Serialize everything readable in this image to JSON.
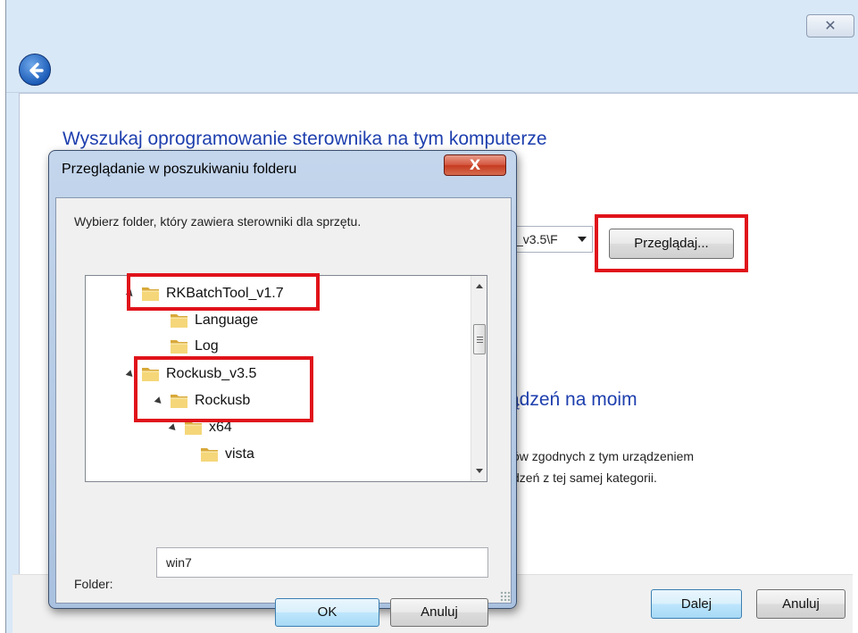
{
  "wizard": {
    "close_glyph": "✕",
    "heading": "Wyszukaj oprogramowanie sterownika na tym komputerze",
    "path_value": "_v3.5\\F",
    "browse_label": "Przeglądaj...",
    "option2_title": "ądzeń na moim",
    "option2_desc": [
      "ów zgodnych z tym urządzeniem",
      "dzeń z tej samej kategorii."
    ],
    "next_label": "Dalej",
    "cancel_label": "Anuluj"
  },
  "dialog": {
    "title": "Przeglądanie w poszukiwaniu folderu",
    "close_glyph": "X",
    "instruction": "Wybierz folder, który zawiera sterowniki dla sprzętu.",
    "tree": [
      {
        "label": "RKBatchTool_v1.7",
        "level": 0,
        "expanded": true
      },
      {
        "label": "Language",
        "level": 1,
        "expanded": false
      },
      {
        "label": "Log",
        "level": 1,
        "expanded": false
      },
      {
        "label": "Rockusb_v3.5",
        "level": 0,
        "expanded": true
      },
      {
        "label": "Rockusb",
        "level": 1,
        "expanded": true
      },
      {
        "label": "x64",
        "level": 2,
        "expanded": true
      },
      {
        "label": "vista",
        "level": 3,
        "expanded": false
      }
    ],
    "folder_label": "Folder:",
    "folder_value": "win7",
    "ok_label": "OK",
    "cancel_label": "Anuluj"
  },
  "colors": {
    "highlight": "#e0131a",
    "heading_blue": "#1e3fae"
  },
  "icons": {
    "back": "back-arrow-icon",
    "folder": "folder-icon",
    "expand": "expanded-triangle-icon"
  }
}
